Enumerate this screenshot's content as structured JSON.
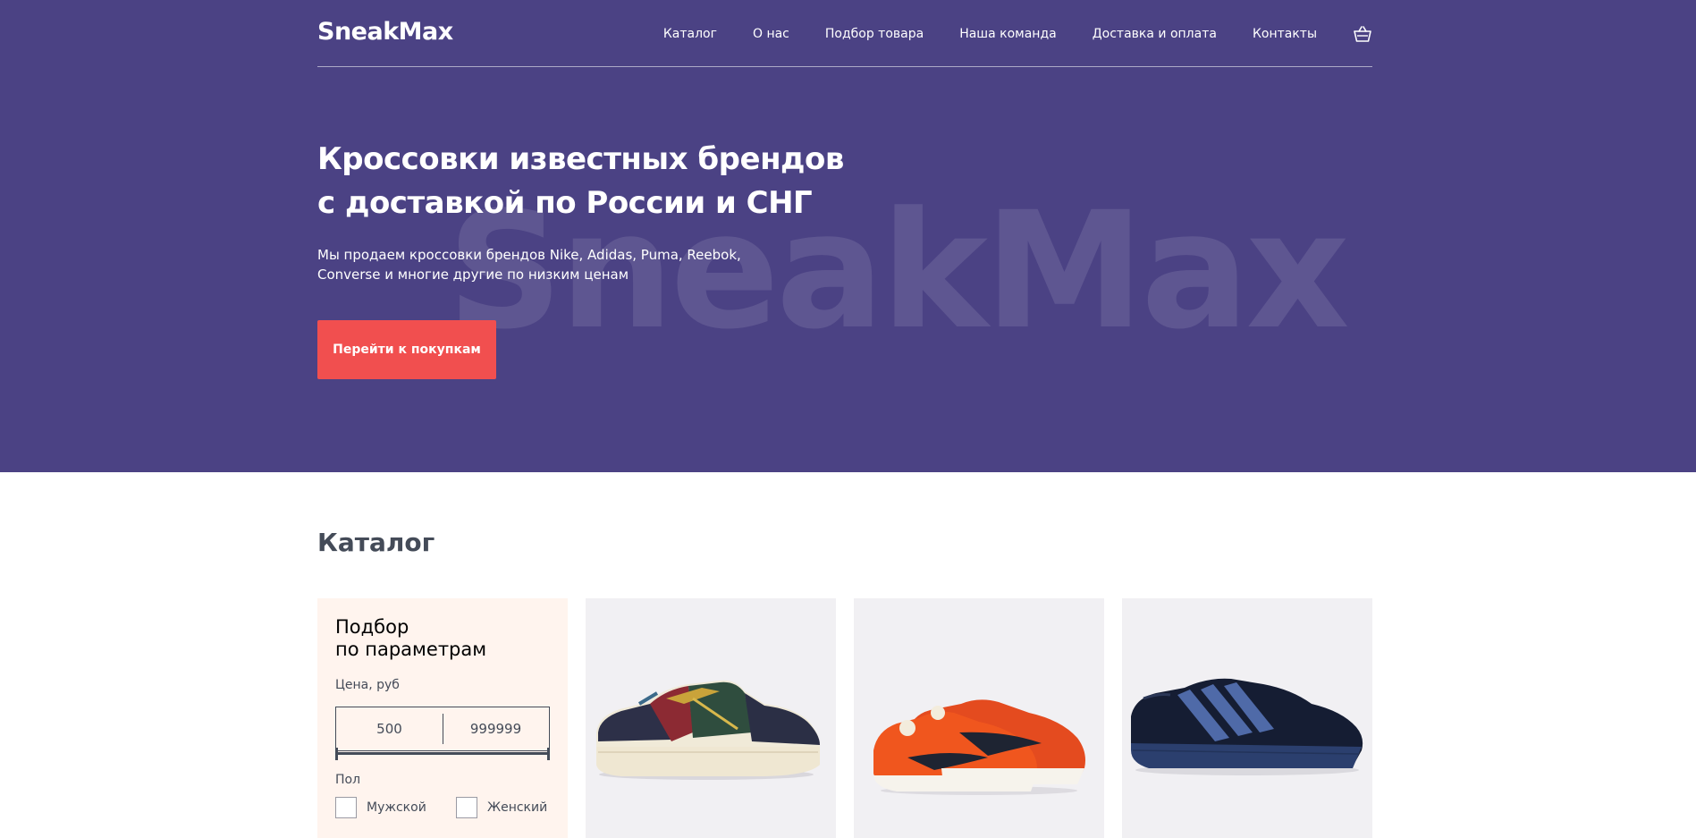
{
  "header": {
    "logo": "SneakMax",
    "nav": [
      {
        "label": "Каталог"
      },
      {
        "label": "О нас"
      },
      {
        "label": "Подбор товара"
      },
      {
        "label": "Наша команда"
      },
      {
        "label": "Доставка и оплата"
      },
      {
        "label": "Контакты"
      }
    ],
    "cart_icon": "basket-icon"
  },
  "hero": {
    "title_line1": "Кроссовки известных брендов",
    "title_line2": "с доставкой по России и СНГ",
    "text_line1": "Мы продаем кроссовки брендов Nike, Adidas, Puma, Reebok,",
    "text_line2": "Converse и многие другие по низким ценам",
    "button_label": "Перейти к покупкам",
    "watermark": "SneakMax"
  },
  "catalog": {
    "title": "Каталог",
    "filter": {
      "title_line1": "Подбор",
      "title_line2": "по параметрам",
      "price_label": "Цена, руб",
      "price_min": "500",
      "price_max": "999999",
      "gender_label": "Пол",
      "gender_options": [
        {
          "label": "Мужской"
        },
        {
          "label": "Женский"
        }
      ]
    },
    "products": [
      {
        "image": "reebok-sneaker-multicolor"
      },
      {
        "image": "nike-sneaker-orange"
      },
      {
        "image": "adidas-sneaker-navy"
      }
    ]
  },
  "colors": {
    "hero_bg": "#4b4284",
    "accent": "#f14f4f",
    "filter_bg": "#fff4ee",
    "card_bg": "#f1f0f3",
    "text": "#444b58"
  }
}
